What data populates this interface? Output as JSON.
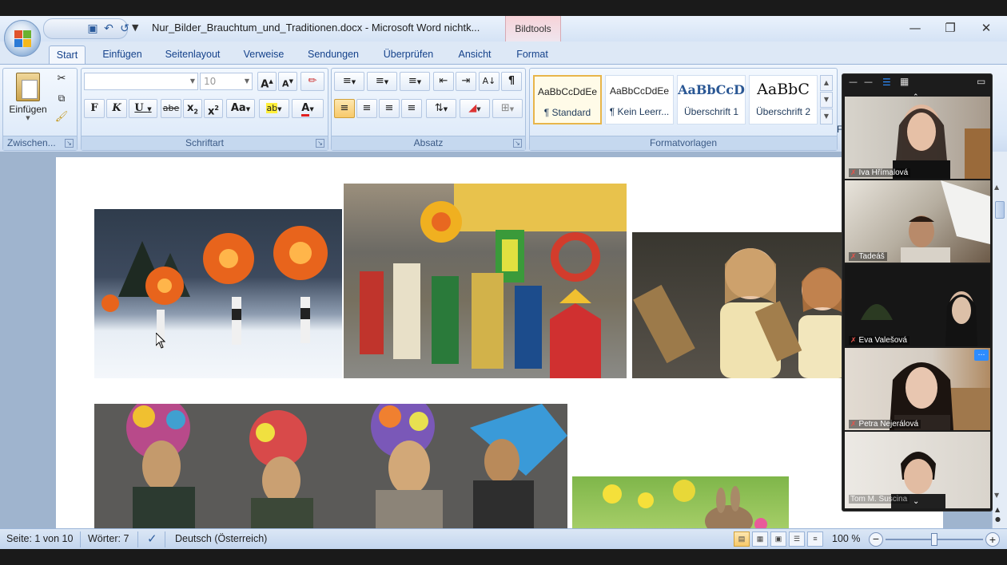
{
  "window": {
    "doc_title": "Nur_Bilder_Brauchtum_und_Traditionen.docx - Microsoft Word nichtk...",
    "context_tab_group": "Bildtools"
  },
  "tabs": [
    "Start",
    "Einfügen",
    "Seitenlayout",
    "Verweise",
    "Sendungen",
    "Überprüfen",
    "Ansicht",
    "Format"
  ],
  "ribbon": {
    "clipboard": {
      "paste_label": "Einfügen",
      "group_label": "Zwischen..."
    },
    "font": {
      "font_name": "",
      "font_size": "10",
      "group_label": "Schriftart"
    },
    "paragraph": {
      "group_label": "Absatz"
    },
    "styles": {
      "group_label": "Formatvorlagen",
      "items": [
        {
          "sample": "AaBbCcDdEe",
          "name": "¶ Standard",
          "selected": true
        },
        {
          "sample": "AaBbCcDdEe",
          "name": "¶ Kein Leerr...",
          "selected": false
        },
        {
          "sample": "AaBbCcD",
          "name": "Überschrift 1",
          "selected": false
        },
        {
          "sample": "AaBbC",
          "name": "Überschrift 2",
          "selected": false
        }
      ]
    },
    "partial_label": "F"
  },
  "status_bar": {
    "page": "Seite: 1 von 10",
    "words": "Wörter: 7",
    "language": "Deutsch (Österreich)",
    "zoom": "100 %"
  },
  "video_call": {
    "participants": [
      {
        "name": "Iva Hřímalová"
      },
      {
        "name": "Tadeáš"
      },
      {
        "name": "Eva Valešová"
      },
      {
        "name": "Petra Nejerálová"
      },
      {
        "name": "Tom M. Suscina"
      }
    ]
  },
  "colors": {
    "ribbon_bg": "#dae7f7",
    "tab_text": "#15428b",
    "selected_style_border": "#e8b54a",
    "bildtools_tint": "#f7d3d8",
    "call_bg": "#1c1c1c",
    "mic_muted": "#e5534b"
  },
  "icons": [
    "office-button-icon",
    "save-icon",
    "undo-icon",
    "redo-icon",
    "paste-icon",
    "cut-icon",
    "copy-icon",
    "format-painter-icon",
    "bold-icon",
    "italic-icon",
    "underline-icon",
    "strikethrough-icon",
    "subscript-icon",
    "superscript-icon",
    "change-case-icon",
    "highlight-icon",
    "font-color-icon",
    "bullets-icon",
    "numbering-icon",
    "multilevel-icon",
    "decrease-indent-icon",
    "increase-indent-icon",
    "sort-icon",
    "pilcrow-icon",
    "align-left-icon",
    "center-icon",
    "align-right-icon",
    "justify-icon",
    "line-spacing-icon",
    "shading-icon",
    "borders-icon",
    "help-icon",
    "microphone-muted-icon"
  ]
}
